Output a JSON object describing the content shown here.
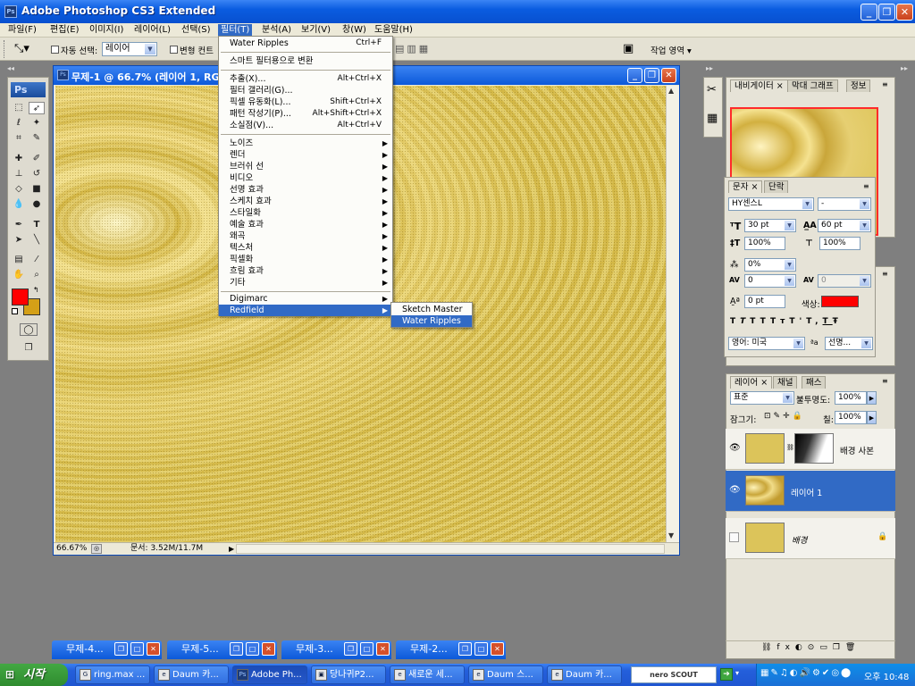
{
  "app": {
    "title": "Adobe Photoshop CS3 Extended",
    "icon": "Ps"
  },
  "menubar": {
    "items": [
      "파일(F)",
      "편집(E)",
      "이미지(I)",
      "레이어(L)",
      "선택(S)",
      "필터(T)",
      "분석(A)",
      "보기(V)",
      "창(W)",
      "도움말(H)"
    ],
    "active_index": 5
  },
  "options_bar": {
    "auto_select_label": "자동 선택:",
    "auto_select_value": "레이어",
    "transform_label": "변형 컨트",
    "workspace_label": "작업 영역 ▾"
  },
  "toolbox": {
    "badge": "Ps"
  },
  "document": {
    "title": "무제-1 @ 66.7% (레이어 1, RG",
    "zoom": "66.67%",
    "doc_info": "문서: 3.52M/11.7M"
  },
  "filter_menu": {
    "top_items": [
      {
        "label": "Water Ripples",
        "shortcut": "Ctrl+F"
      }
    ],
    "smart": {
      "label": "스마트 필터용으로 변환"
    },
    "tool_items": [
      {
        "label": "추출(X)...",
        "shortcut": "Alt+Ctrl+X"
      },
      {
        "label": "필터 갤러리(G)...",
        "shortcut": ""
      },
      {
        "label": "픽셀 유동화(L)...",
        "shortcut": "Shift+Ctrl+X"
      },
      {
        "label": "패턴 작성기(P)...",
        "shortcut": "Alt+Shift+Ctrl+X"
      },
      {
        "label": "소실점(V)...",
        "shortcut": "Alt+Ctrl+V"
      }
    ],
    "groups": [
      "노이즈",
      "렌더",
      "브러쉬 선",
      "비디오",
      "선명 효과",
      "스케치 효과",
      "스타일화",
      "예술 효과",
      "왜곡",
      "텍스처",
      "픽셀화",
      "흐림 효과",
      "기타"
    ],
    "plugins": [
      "Digimarc",
      "Redfield"
    ],
    "highlighted": "Redfield"
  },
  "submenu": {
    "items": [
      "Sketch Master",
      "Water Ripples"
    ],
    "highlighted": "Water Ripples"
  },
  "navigator_panel": {
    "tabs": [
      "내비게이터",
      "막대 그래프",
      "정보"
    ]
  },
  "char_panel": {
    "tabs": [
      "문자",
      "단락"
    ],
    "font_family": "HY센스L",
    "font_style": "-",
    "size": "30 pt",
    "leading": "60 pt",
    "vscale": "100%",
    "hscale": "100%",
    "tracking_ratio": "0%",
    "kerning": "0",
    "tracking": "0",
    "baseline": "0 pt",
    "color_label": "색상:",
    "color": "#ff0000",
    "language": "영어: 미국",
    "antialias": "선명...",
    "style_buttons": [
      "T",
      "T",
      "TT",
      "Tт",
      "T'",
      "T,",
      "T",
      "Ŧ"
    ]
  },
  "layers_panel": {
    "tabs": [
      "레이어",
      "채널",
      "패스"
    ],
    "blend_mode": "표준",
    "opacity_label": "불투명도:",
    "opacity": "100%",
    "lock_label": "잠그기:",
    "fill_label": "칠:",
    "fill": "100%",
    "layers": [
      {
        "name": "배경 사본",
        "visible": true,
        "selected": false,
        "has_mask": true
      },
      {
        "name": "레이어 1",
        "visible": true,
        "selected": true,
        "has_mask": false
      },
      {
        "name": "배경",
        "visible": false,
        "selected": false,
        "has_mask": false,
        "locked": true
      }
    ]
  },
  "minimized_docs": [
    "무제-4...",
    "무제-5...",
    "무제-3...",
    "무제-2..."
  ],
  "taskbar": {
    "start": "시작",
    "buttons": [
      "ring.max ...",
      "Daum 카...",
      "Adobe Ph...",
      "당나귀P2...",
      "새로운 세...",
      "Daum 스...",
      "Daum 카..."
    ],
    "active_index": 2,
    "search_brand": "nero SCOUT",
    "clock": "오후 10:48"
  },
  "colors": {
    "xp_blue": "#0a5ce0",
    "menu_highlight": "#316ac5",
    "foreground": "#ff0000",
    "background": "#d4a017",
    "canvas_gold": "#d9c04e"
  }
}
